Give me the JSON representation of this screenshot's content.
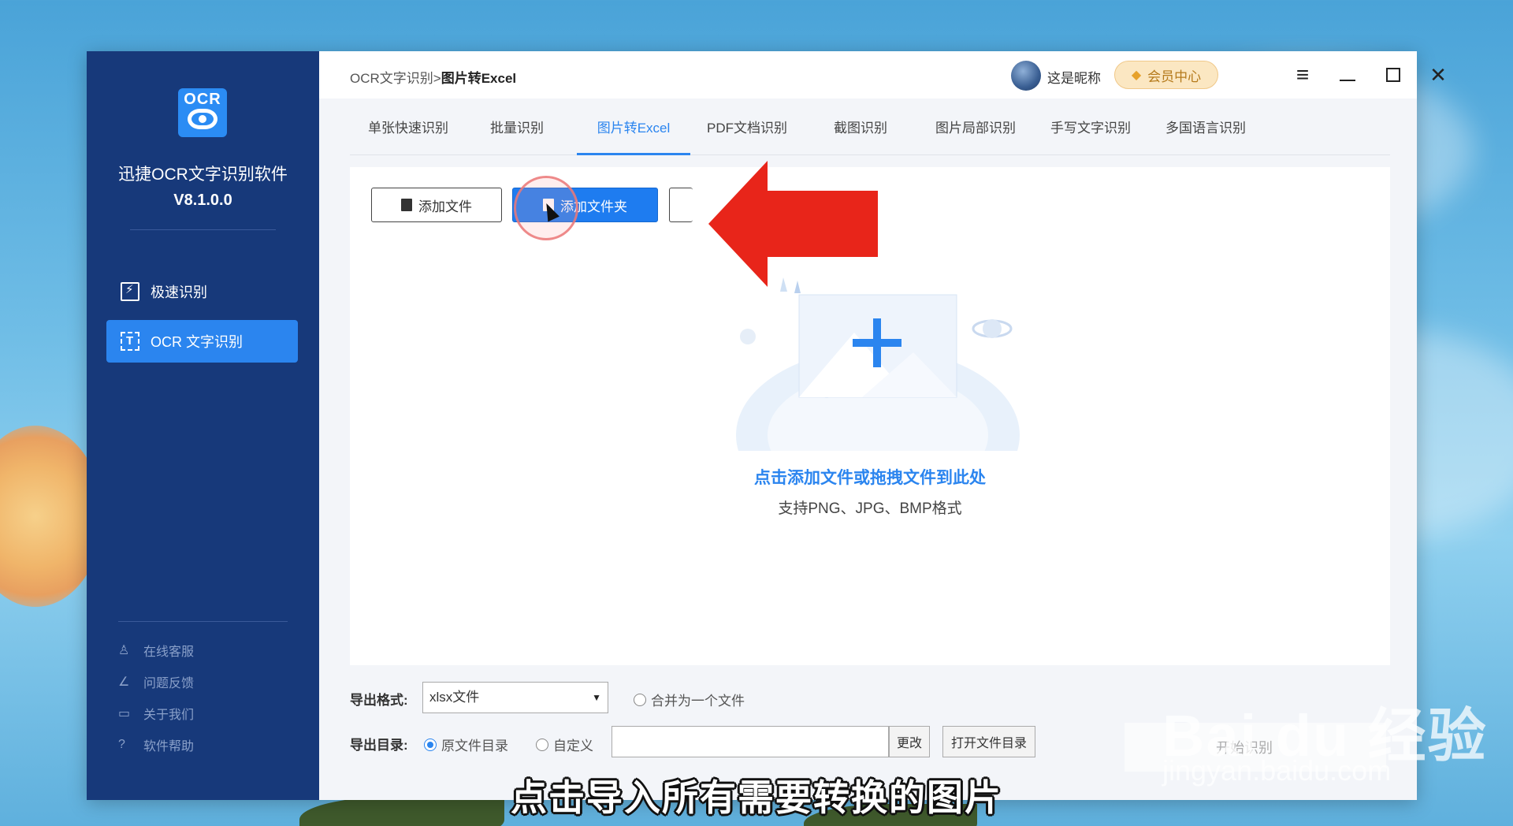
{
  "sidebar": {
    "logo_text": "OCR",
    "app_name": "迅捷OCR文字识别软件",
    "version": "V8.1.0.0",
    "nav": [
      {
        "label": "极速识别",
        "icon": "fast-recognize-icon"
      },
      {
        "label": "OCR 文字识别",
        "icon": "ocr-scan-icon",
        "active": true
      }
    ],
    "help": [
      {
        "label": "在线客服",
        "icon": "user-icon"
      },
      {
        "label": "问题反馈",
        "icon": "edit-icon"
      },
      {
        "label": "关于我们",
        "icon": "chat-icon"
      },
      {
        "label": "软件帮助",
        "icon": "question-icon"
      }
    ]
  },
  "header": {
    "breadcrumb_parent": "OCR文字识别",
    "breadcrumb_sep": ">",
    "breadcrumb_current": "图片转Excel",
    "nickname": "这是昵称",
    "vip_label": "会员中心"
  },
  "tabs": [
    {
      "label": "单张快速识别"
    },
    {
      "label": "批量识别"
    },
    {
      "label": "图片转Excel",
      "active": true
    },
    {
      "label": "PDF文档识别"
    },
    {
      "label": "截图识别"
    },
    {
      "label": "图片局部识别"
    },
    {
      "label": "手写文字识别"
    },
    {
      "label": "多国语言识别"
    }
  ],
  "toolbar": {
    "add_file": "添加文件",
    "add_folder": "添加文件夹"
  },
  "dropzone": {
    "title": "点击添加文件或拖拽文件到此处",
    "subtitle": "支持PNG、JPG、BMP格式"
  },
  "export": {
    "format_label": "导出格式:",
    "format_value": "xlsx文件",
    "merge_label": "合并为一个文件",
    "dir_label": "导出目录:",
    "dir_original": "原文件目录",
    "dir_custom": "自定义",
    "path_value": "",
    "change_btn": "更改",
    "open_dir_btn": "打开文件目录",
    "start_btn": "开始识别"
  },
  "overlay": {
    "subtitle": "点击导入所有需要转换的图片",
    "watermark_brand": "Bai du 经验",
    "watermark_url": "jingyan.baidu.com"
  },
  "colors": {
    "sidebar_bg": "#17397a",
    "accent": "#2b85ef",
    "primary_button": "#1e7cf0",
    "arrow": "#e8251a"
  }
}
